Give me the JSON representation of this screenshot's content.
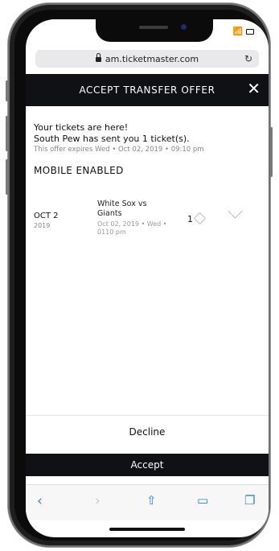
{
  "browser": {
    "url": "am.ticketmaster.com"
  },
  "header": {
    "title": "ACCEPT TRANSFER OFFER",
    "close_glyph": "✕"
  },
  "message": {
    "title": "Your tickets are here!",
    "sender_line": "South Pew has sent you 1 ticket(s).",
    "expiry": "This offer expires Wed • Oct 02, 2019 • 09:10 pm",
    "delivery_label": "MOBILE ENABLED"
  },
  "ticket": {
    "date_main": "OCT 2",
    "date_year": "2019",
    "event_name": "White Sox vs Giants",
    "event_meta": "Oct 02, 2019 • Wed • 0110 pm",
    "quantity": "1"
  },
  "actions": {
    "decline_label": "Decline",
    "accept_label": "Accept"
  },
  "icons": {
    "back": "chevron-left-icon",
    "forward": "chevron-right-icon",
    "share": "share-icon",
    "bookmarks": "bookmarks-icon",
    "tabs": "tabs-icon",
    "reload": "reload-icon",
    "lock": "lock-icon",
    "tag": "ticket-tag-icon",
    "expand": "chevron-down-icon"
  },
  "colors": {
    "header_bg": "#0f1115",
    "accent_blue": "#2f7cf6",
    "text_muted": "#888888"
  }
}
